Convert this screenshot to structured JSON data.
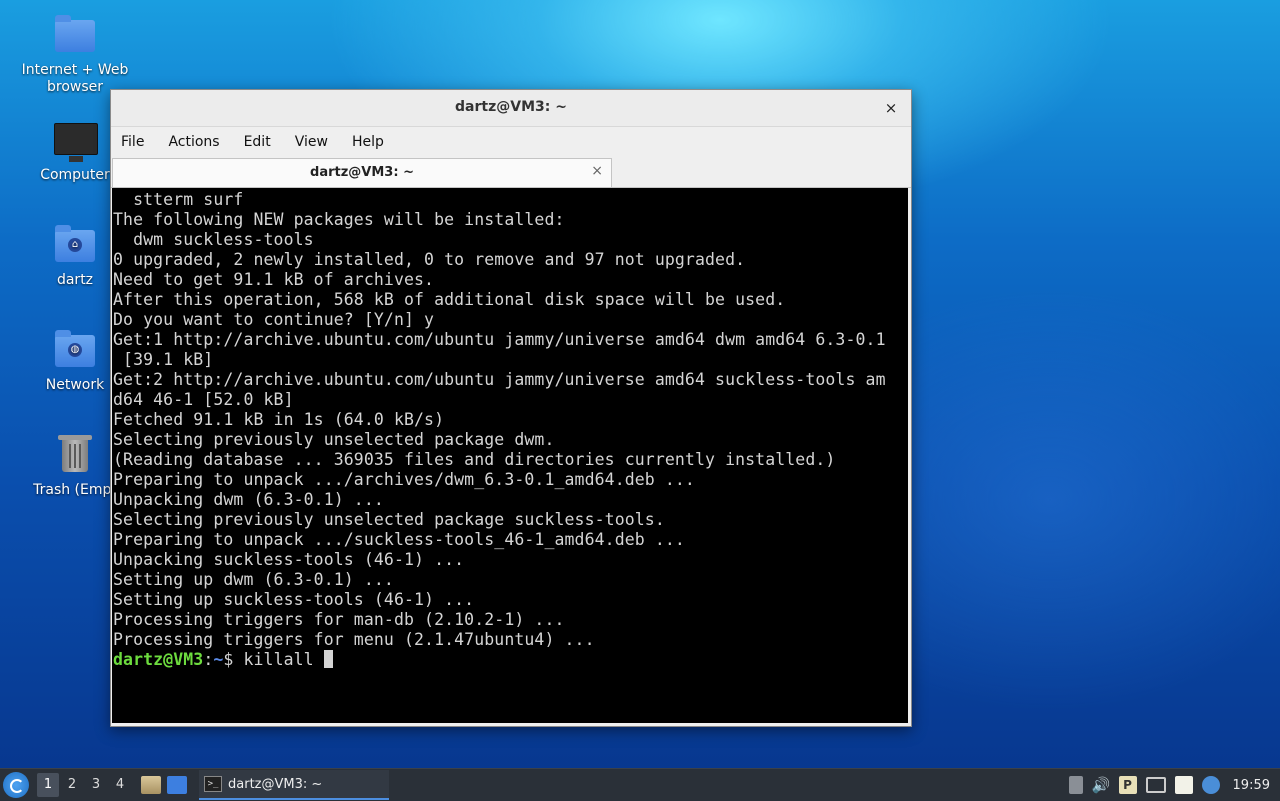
{
  "desktop": {
    "icons": [
      {
        "label": "Internet + Web browser",
        "icon": "folder-icon"
      },
      {
        "label": "Computer",
        "icon": "computer-icon"
      },
      {
        "label": "dartz",
        "icon": "home-folder-icon"
      },
      {
        "label": "Network",
        "icon": "network-folder-icon"
      },
      {
        "label": "Trash (Empt",
        "icon": "trash-icon"
      }
    ]
  },
  "window": {
    "title": "dartz@VM3: ~",
    "close_glyph": "×",
    "menu": [
      "File",
      "Actions",
      "Edit",
      "View",
      "Help"
    ],
    "tab_title": "dartz@VM3: ~",
    "tab_close_glyph": "×"
  },
  "terminal": {
    "lines": [
      "  stterm surf",
      "The following NEW packages will be installed:",
      "  dwm suckless-tools",
      "0 upgraded, 2 newly installed, 0 to remove and 97 not upgraded.",
      "Need to get 91.1 kB of archives.",
      "After this operation, 568 kB of additional disk space will be used.",
      "Do you want to continue? [Y/n] y",
      "Get:1 http://archive.ubuntu.com/ubuntu jammy/universe amd64 dwm amd64 6.3-0.1",
      " [39.1 kB]",
      "Get:2 http://archive.ubuntu.com/ubuntu jammy/universe amd64 suckless-tools am",
      "d64 46-1 [52.0 kB]",
      "Fetched 91.1 kB in 1s (64.0 kB/s)",
      "Selecting previously unselected package dwm.",
      "(Reading database ... 369035 files and directories currently installed.)",
      "Preparing to unpack .../archives/dwm_6.3-0.1_amd64.deb ...",
      "Unpacking dwm (6.3-0.1) ...",
      "Selecting previously unselected package suckless-tools.",
      "Preparing to unpack .../suckless-tools_46-1_amd64.deb ...",
      "Unpacking suckless-tools (46-1) ...",
      "Setting up dwm (6.3-0.1) ...",
      "Setting up suckless-tools (46-1) ...",
      "Processing triggers for man-db (2.10.2-1) ...",
      "Processing triggers for menu (2.1.47ubuntu4) ..."
    ],
    "prompt_user": "dartz@VM3",
    "prompt_sep": ":",
    "prompt_path": "~",
    "prompt_symbol": "$ ",
    "command": "killall "
  },
  "taskbar": {
    "workspaces": [
      "1",
      "2",
      "3",
      "4"
    ],
    "active_workspace": "1",
    "task_label": "dartz@VM3: ~",
    "clock": "19:59",
    "tray_icons": [
      "clipboard-icon",
      "volume-icon",
      "parcellite-icon",
      "network-icon",
      "notes-icon",
      "updates-icon"
    ]
  }
}
